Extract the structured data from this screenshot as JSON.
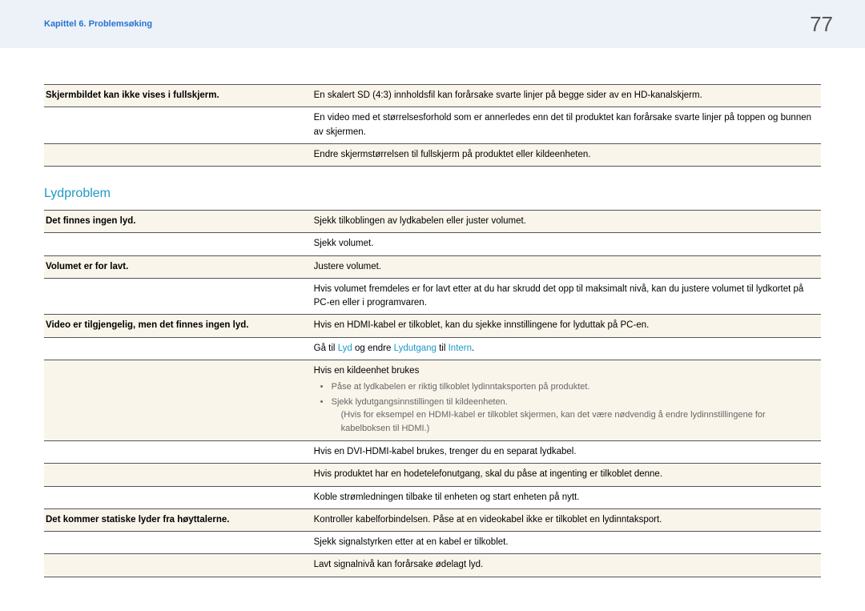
{
  "header": {
    "chapter": "Kapittel 6. Problemsøking",
    "page": "77"
  },
  "table1": {
    "r1": {
      "left": "Skjermbildet kan ikke vises i fullskjerm.",
      "right": "En skalert SD (4:3) innholdsfil kan forårsake svarte linjer på begge sider av en HD-kanalskjerm."
    },
    "r2": "En video med et størrelsesforhold som er annerledes enn det til produktet kan forårsake svarte linjer på toppen og bunnen av skjermen.",
    "r3": "Endre skjermstørrelsen til fullskjerm på produktet eller kildeenheten."
  },
  "section_title": "Lydproblem",
  "table2": {
    "r1": {
      "left": "Det finnes ingen lyd.",
      "right": "Sjekk tilkoblingen av lydkabelen eller juster volumet."
    },
    "r2": "Sjekk volumet.",
    "r3": {
      "left": "Volumet er for lavt.",
      "right": "Justere volumet."
    },
    "r4": "Hvis volumet fremdeles er for lavt etter at du har skrudd det opp til maksimalt nivå, kan du justere volumet til lydkortet på PC-en eller i programvaren.",
    "r5": {
      "left": "Video er tilgjengelig, men det finnes ingen lyd.",
      "right_pre": "Gå til ",
      "hl1": "Lyd",
      "mid": " og endre ",
      "hl2": "Lydutgang",
      "mid2": " til ",
      "hl3": "Intern",
      "post": ".",
      "pretext": "Hvis en HDMI-kabel er tilkoblet, kan du sjekke innstillingene for lyduttak på PC-en."
    },
    "r6": {
      "intro": "Hvis en kildeenhet brukes",
      "b1": "Påse at lydkabelen er riktig tilkoblet lydinntaksporten på produktet.",
      "b2": "Sjekk lydutgangsinnstillingen til kildeenheten.",
      "paren": "(Hvis for eksempel en HDMI-kabel er tilkoblet skjermen, kan det være nødvendig å endre lydinnstillingene for kabelboksen til HDMI.)"
    },
    "r7": "Hvis en DVI-HDMI-kabel brukes, trenger du en separat lydkabel.",
    "r8": "Hvis produktet har en hodetelefonutgang, skal du påse at ingenting er tilkoblet denne.",
    "r9": "Koble strømledningen tilbake til enheten og start enheten på nytt.",
    "r10": {
      "left": "Det kommer statiske lyder fra høyttalerne.",
      "right": "Kontroller kabelforbindelsen. Påse at en videokabel ikke er tilkoblet en lydinntaksport."
    },
    "r11": "Sjekk signalstyrken etter at en kabel er tilkoblet.",
    "r12": "Lavt signalnivå kan forårsake ødelagt lyd."
  }
}
